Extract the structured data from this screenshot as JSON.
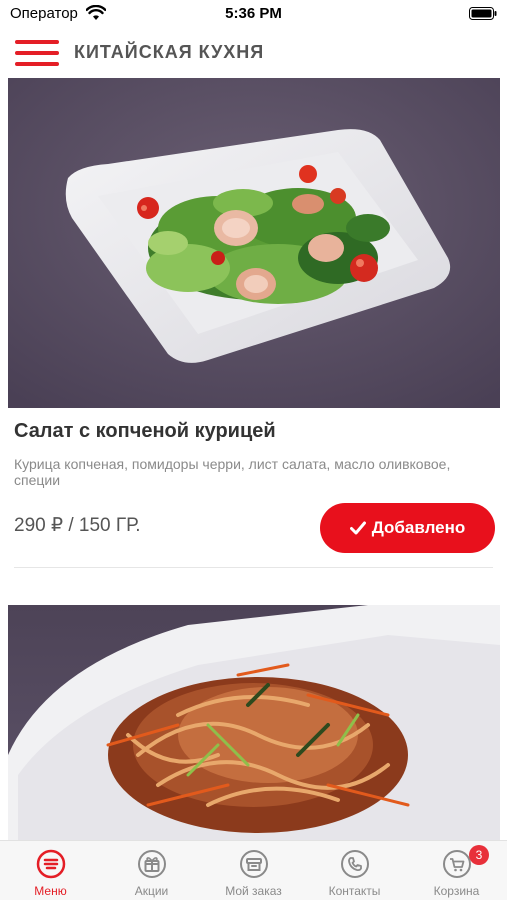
{
  "status_bar": {
    "carrier": "Оператор",
    "time": "5:36 PM"
  },
  "header": {
    "title": "КИТАЙСКАЯ КУХНЯ",
    "menu_icon": "hamburger-menu-icon"
  },
  "products": [
    {
      "title": "Салат с копченой курицей",
      "description": "Курица копченая, помидоры черри, лист салата, масло оливковое, специи",
      "price": "290 ₽ / 150 ГР.",
      "button_label": "Добавлено",
      "button_icon": "check-icon"
    },
    {
      "title": "",
      "description": "",
      "price": ""
    }
  ],
  "tab_bar": {
    "active": "menu",
    "accent_color": "#e41e26",
    "inactive_color": "#8a8a8a",
    "tabs": [
      {
        "id": "menu",
        "label": "Меню",
        "icon": "menu-list-icon"
      },
      {
        "id": "promo",
        "label": "Акции",
        "icon": "gift-icon"
      },
      {
        "id": "order",
        "label": "Мой заказ",
        "icon": "order-box-icon"
      },
      {
        "id": "contacts",
        "label": "Контакты",
        "icon": "phone-icon"
      },
      {
        "id": "cart",
        "label": "Корзина",
        "icon": "cart-icon",
        "badge": "3"
      }
    ]
  },
  "colors": {
    "brand_red": "#e8101c",
    "photo_background": "#5a4f63"
  }
}
